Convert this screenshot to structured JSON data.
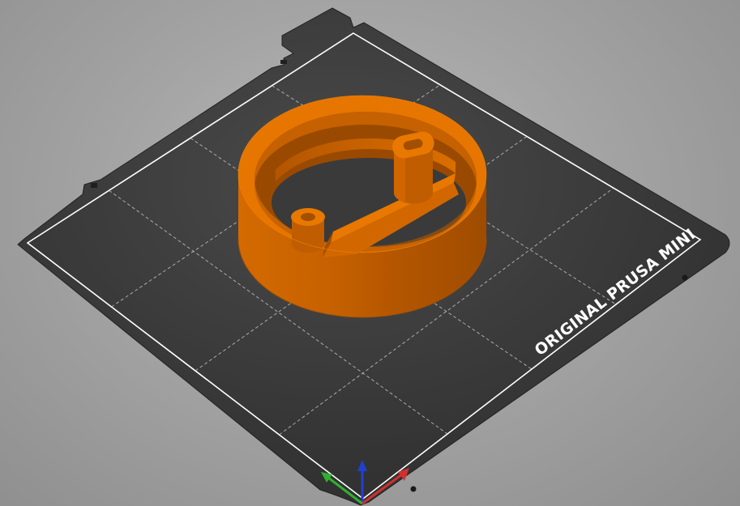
{
  "viewport": {
    "background": "#a9a9a9"
  },
  "bed": {
    "label": "ORIGINAL PRUSA MINI",
    "sheet_color": "#333333",
    "print_area_border_color": "#ffffff",
    "grid_color": "#d0d0d0",
    "grid_divisions": 4
  },
  "model": {
    "color": "#e07000",
    "shadow_color": "#b25500"
  },
  "axes": {
    "x_color": "#e03030",
    "y_color": "#30b030",
    "z_color": "#2040d0"
  }
}
